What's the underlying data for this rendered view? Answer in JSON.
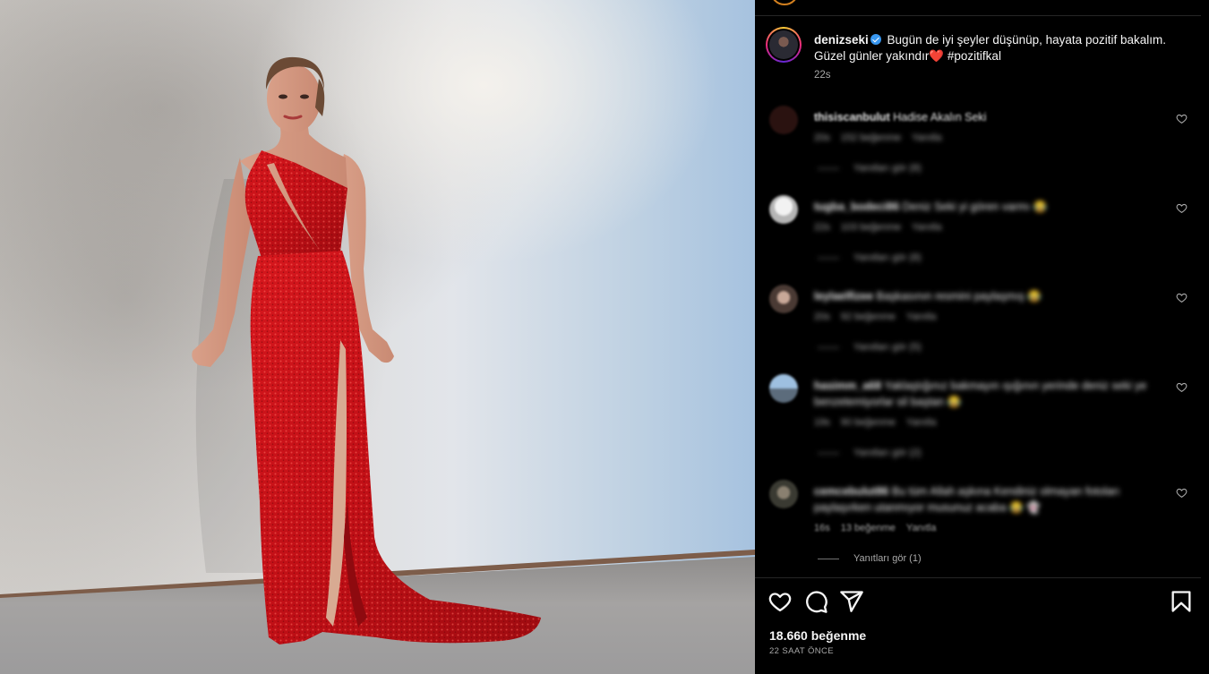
{
  "post": {
    "username": "denizseki",
    "caption_line1": "Bugün de iyi şeyler düşünüp, hayata pozitif bakalım.",
    "caption_line2": "Güzel günler yakındır",
    "heart": "❤️",
    "hashtag": "#pozitifkal",
    "time_ago": "22s",
    "likes": "18.660 beğenme",
    "date": "22 SAAT ÖNCE"
  },
  "comments": [
    {
      "user": "thisiscanbulut",
      "text": "Hadise Akalın Seki",
      "time": "20s",
      "likes": "152 beğenme",
      "reply": "Yanıtla",
      "replies": "Yanıtları gör (8)",
      "avatar_color": "#2a1210"
    },
    {
      "user": "tugba_bodeci86",
      "text": "Deniz Seki yi gören varmı 😂",
      "time": "22s",
      "likes": "103 beğenme",
      "reply": "Yanıtla",
      "replies": "Yanıtları gör (8)",
      "avatar_color": "#d8d8d8"
    },
    {
      "user": "leylaelfizee",
      "text": "Başkasının resmini paylaşmış 😂",
      "time": "20s",
      "likes": "92 beğenme",
      "reply": "Yanıtla",
      "replies": "Yanıtları gör (5)",
      "avatar_color": "#8a7a70"
    },
    {
      "user": "hasimm_a68",
      "text": "Yaklaştığınız bakmayın ışığının yerinde deniz seki ye benzetemiyorlar sil baştan 😂",
      "time": "19s",
      "likes": "90 beğenme",
      "reply": "Yanıtla",
      "replies": "Yanıtları gör (2)",
      "avatar_color": "#6a8aa8"
    },
    {
      "user": "cemcebulut86",
      "text": "Bu tüm Allah aşkına Kendiniz olmayan fotoları paylaşırken utanmıyor musunuz acaba 😂 👻",
      "time": "16s",
      "likes": "13 beğenme",
      "reply": "Yanıtla",
      "replies": "Yanıtları gör (1)",
      "avatar_color": "#4a4a40"
    }
  ],
  "icons": {
    "like": "heart-icon",
    "comment": "comment-icon",
    "share": "share-icon",
    "save": "bookmark-icon"
  },
  "colors": {
    "background": "#000000",
    "dress": "#c8141a",
    "verified": "#3897f0",
    "muted_text": "#a8a8a8"
  }
}
